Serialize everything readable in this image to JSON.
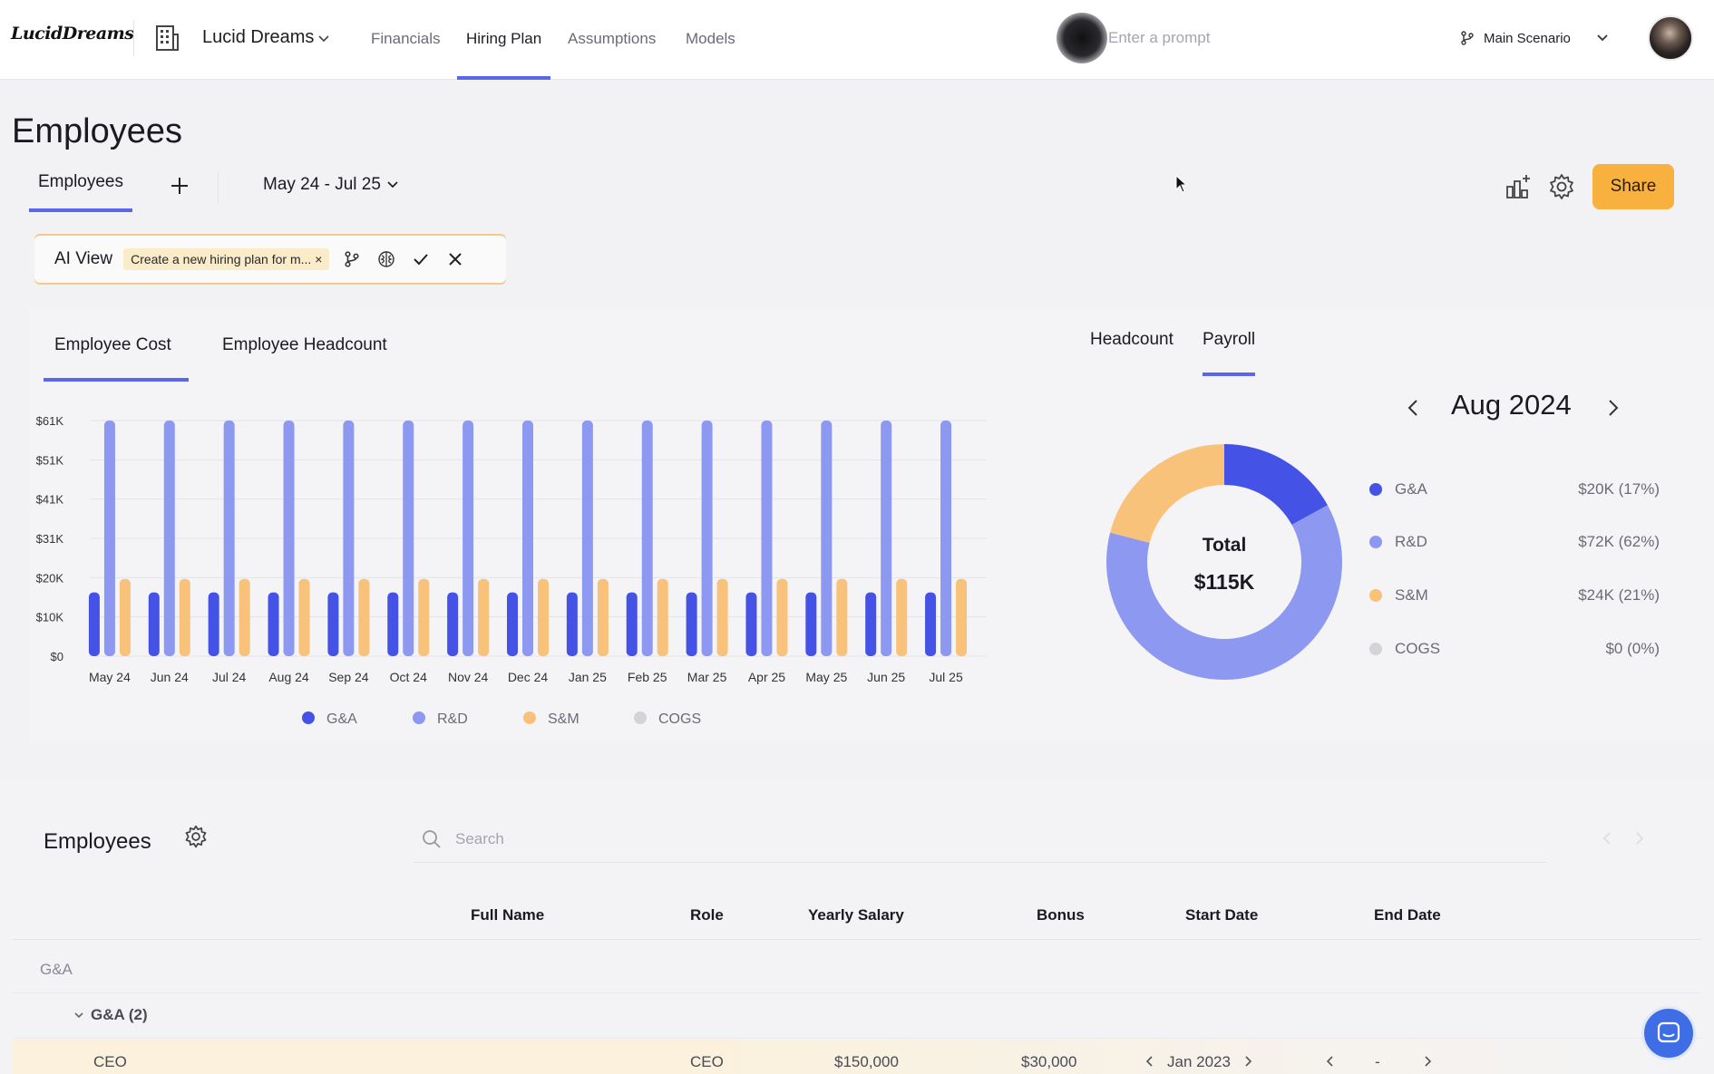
{
  "header": {
    "logo": "LucidDreams",
    "company_name": "Lucid Dreams",
    "nav": [
      {
        "label": "Financials",
        "active": false
      },
      {
        "label": "Hiring Plan",
        "active": true
      },
      {
        "label": "Assumptions",
        "active": false
      },
      {
        "label": "Models",
        "active": false
      }
    ],
    "prompt_placeholder": "Enter a prompt",
    "scenario": "Main Scenario"
  },
  "page": {
    "title": "Employees",
    "tab": "Employees",
    "date_range": "May 24 - Jul 25",
    "share_label": "Share"
  },
  "ai_view": {
    "label": "AI View",
    "chip": "Create a new hiring plan for m..."
  },
  "chart_tabs": {
    "left": [
      "Employee Cost",
      "Employee Headcount"
    ],
    "right": [
      "Headcount",
      "Payroll"
    ]
  },
  "colors": {
    "ga": "#4452e6",
    "rd": "#8d98f0",
    "sm": "#f8c27a",
    "cogs": "#d4d4d8",
    "accent": "#5b67e8",
    "share": "#f8b13f"
  },
  "chart_data": [
    {
      "type": "bar",
      "categories": [
        "May 24",
        "Jun 24",
        "Jul 24",
        "Aug 24",
        "Sep 24",
        "Oct 24",
        "Nov 24",
        "Dec 24",
        "Jan 25",
        "Feb 25",
        "Mar 25",
        "Apr 25",
        "May 25",
        "Jun 25",
        "Jul 25"
      ],
      "ytick_labels": [
        "$0",
        "$10K",
        "$20K",
        "$31K",
        "$41K",
        "$51K",
        "$61K"
      ],
      "ylim": [
        0,
        61000
      ],
      "series": [
        {
          "name": "G&A",
          "values": [
            16500,
            16500,
            16500,
            16500,
            16500,
            16500,
            16500,
            16500,
            16500,
            16500,
            16500,
            16500,
            16500,
            16500,
            16500
          ]
        },
        {
          "name": "R&D",
          "values": [
            61000,
            61000,
            61000,
            61000,
            61000,
            61000,
            61000,
            61000,
            61000,
            61000,
            61000,
            61000,
            61000,
            61000,
            61000
          ]
        },
        {
          "name": "S&M",
          "values": [
            20000,
            20000,
            20000,
            20000,
            20000,
            20000,
            20000,
            20000,
            20000,
            20000,
            20000,
            20000,
            20000,
            20000,
            20000
          ]
        },
        {
          "name": "COGS",
          "values": [
            0,
            0,
            0,
            0,
            0,
            0,
            0,
            0,
            0,
            0,
            0,
            0,
            0,
            0,
            0
          ]
        }
      ],
      "grid": true,
      "legend": "bottom"
    },
    {
      "type": "pie",
      "month": "Aug 2024",
      "center_label": "Total",
      "center_value": "$115K",
      "slices": [
        {
          "name": "G&A",
          "value": 17,
          "label": "$20K (17%)"
        },
        {
          "name": "R&D",
          "value": 62,
          "label": "$72K (62%)"
        },
        {
          "name": "S&M",
          "value": 21,
          "label": "$24K (21%)"
        },
        {
          "name": "COGS",
          "value": 0,
          "label": "$0 (0%)"
        }
      ],
      "legend": "right"
    }
  ],
  "employees": {
    "title": "Employees",
    "search_placeholder": "Search",
    "columns": [
      "Full Name",
      "Role",
      "Yearly Salary",
      "Bonus",
      "Start Date",
      "End Date"
    ],
    "group": "G&A",
    "subgroup": "G&A (2)",
    "rows": [
      {
        "name": "CEO",
        "role": "CEO",
        "salary": "$150,000",
        "bonus": "$30,000",
        "start": "Jan 2023",
        "end": "-"
      }
    ]
  }
}
